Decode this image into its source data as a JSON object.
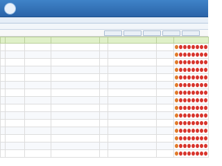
{
  "header": {
    "title": "",
    "logo_icon": "org-logo-icon"
  },
  "status_bar": {
    "text": ""
  },
  "breadcrumb": {
    "text": ""
  },
  "toolbar": {
    "buttons": [
      "",
      "",
      "",
      "",
      ""
    ]
  },
  "table": {
    "columns": [
      "",
      "",
      "",
      "",
      "",
      "",
      "",
      ""
    ],
    "rows_visible": 15,
    "actions_per_row": 8
  },
  "colors": {
    "header": "#2a63a8",
    "table_header": "#dff0c8",
    "action_red": "#d8342c",
    "action_orange": "#e07a2a"
  }
}
